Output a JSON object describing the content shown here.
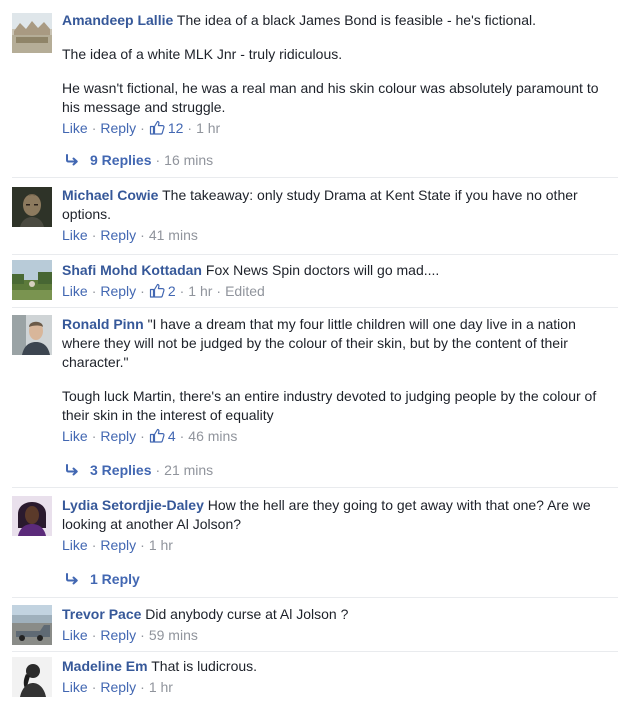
{
  "comments": [
    {
      "name": "Amandeep Lallie",
      "paragraphs": [
        "The idea of a black James Bond is feasible - he's fictional.",
        "The idea of a white MLK Jnr - truly ridiculous.",
        "He wasn't fictional, he was a real man and his skin colour was absolutely paramount to his message and struggle."
      ],
      "like": "Like",
      "reply": "Reply",
      "likes": "12",
      "time": "1 hr",
      "replies": {
        "label": "9 Replies",
        "time": "16 mins"
      }
    },
    {
      "name": "Michael Cowie",
      "paragraphs": [
        "The takeaway: only study Drama at Kent State if you have no other options."
      ],
      "like": "Like",
      "reply": "Reply",
      "time": "41 mins"
    },
    {
      "name": "Shafi Mohd Kottadan",
      "paragraphs": [
        "Fox News Spin doctors will go mad...."
      ],
      "like": "Like",
      "reply": "Reply",
      "likes": "2",
      "time": "1 hr",
      "edited": "Edited"
    },
    {
      "name": "Ronald Pinn",
      "paragraphs": [
        "\"I have a dream that my four little children will one day live in a nation where they will not be judged by the colour of their skin, but by the content of their character.\"",
        "Tough luck Martin, there's an entire industry devoted to judging people by the colour of their skin in the interest of equality"
      ],
      "like": "Like",
      "reply": "Reply",
      "likes": "4",
      "time": "46 mins",
      "replies": {
        "label": "3 Replies",
        "time": "21 mins"
      }
    },
    {
      "name": "Lydia Setordjie-Daley",
      "paragraphs": [
        "How the hell are they going to get away with that one? Are we looking at another Al Jolson?"
      ],
      "like": "Like",
      "reply": "Reply",
      "time": "1 hr",
      "replies": {
        "label": "1 Reply"
      }
    },
    {
      "name": "Trevor Pace",
      "paragraphs": [
        "Did anybody curse at Al Jolson ?"
      ],
      "like": "Like",
      "reply": "Reply",
      "time": "59 mins"
    },
    {
      "name": "Madeline Em",
      "paragraphs": [
        "That is ludicrous."
      ],
      "like": "Like",
      "reply": "Reply",
      "time": "1 hr"
    }
  ],
  "colors": {
    "link": "#365899",
    "action": "#4267b2",
    "meta": "#90949c",
    "text": "#1d2129"
  },
  "icons": {
    "like": "thumbs-up-icon",
    "reply_arrow": "reply-arrow-icon"
  }
}
